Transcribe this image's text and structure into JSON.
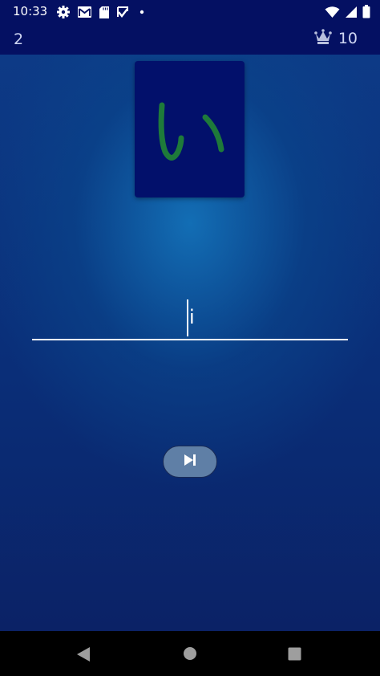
{
  "status_bar": {
    "time": "10:33",
    "icons": [
      "settings-icon",
      "gmail-icon",
      "sd-card-icon",
      "app-notification-icon",
      "dot-icon"
    ],
    "right_icons": [
      "wifi-icon",
      "signal-icon",
      "battery-icon"
    ]
  },
  "header": {
    "score": "2",
    "best_icon": "crown-icon",
    "best_score": "10"
  },
  "card": {
    "character": "い",
    "character_color": "#1e7a3a",
    "background": "#02106b"
  },
  "answer": {
    "typed_text": "i"
  },
  "skip_button": {
    "icon": "skip-next-icon"
  },
  "nav_bar": {
    "icons": [
      "back-icon",
      "home-icon",
      "recents-icon"
    ]
  },
  "colors": {
    "app_bar": "#041062",
    "background_accent": "#1478be"
  }
}
